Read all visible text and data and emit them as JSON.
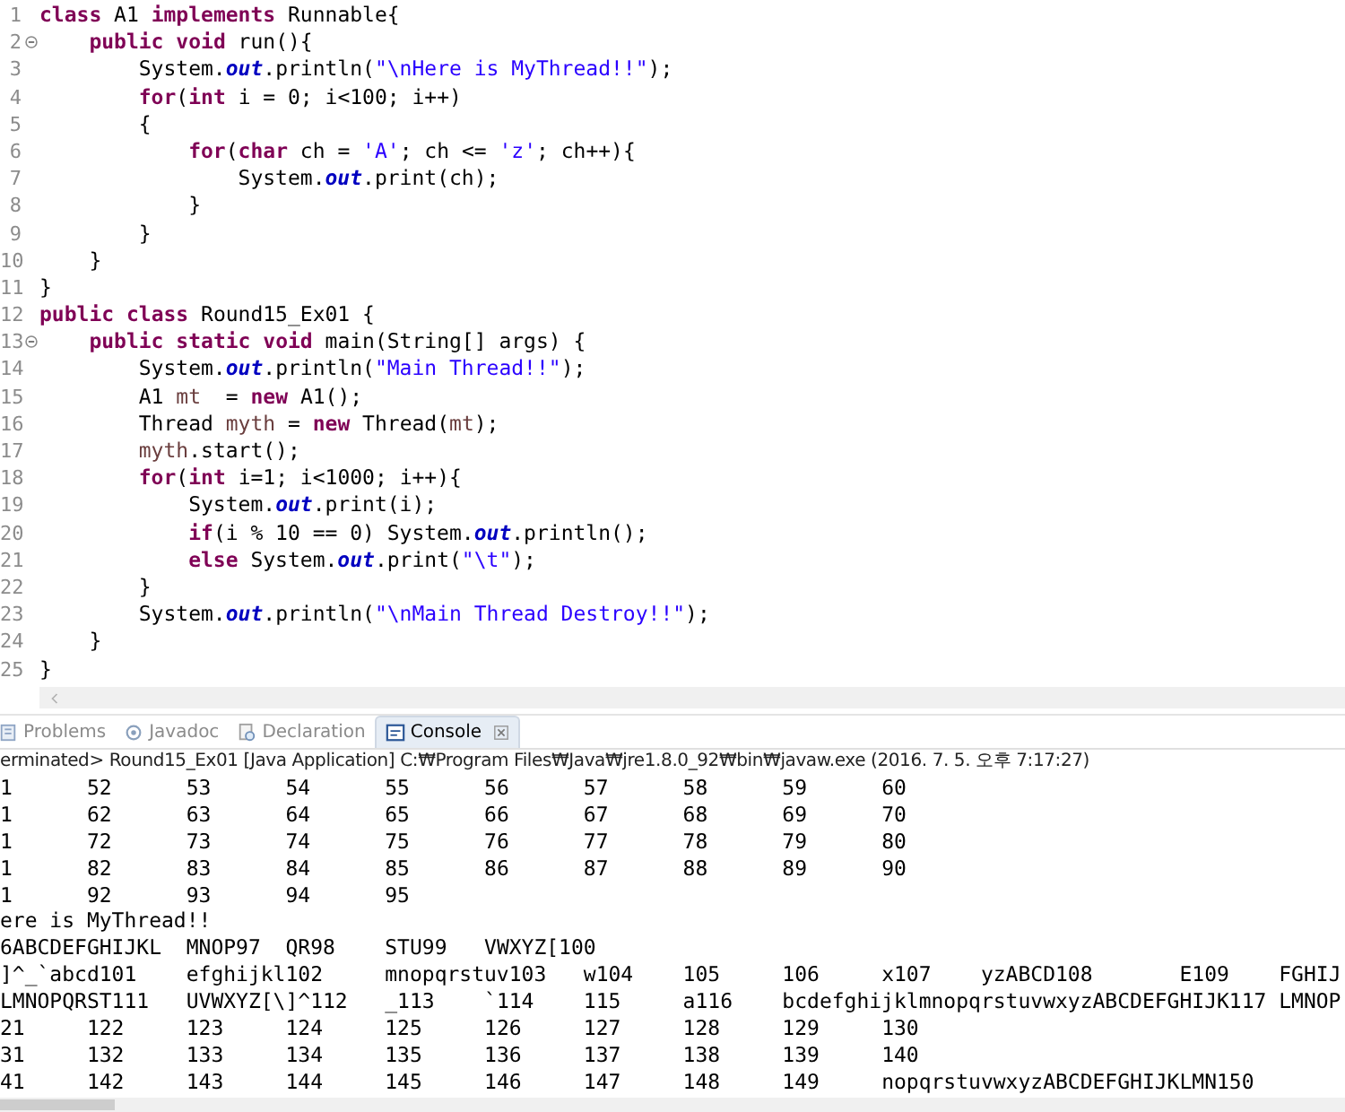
{
  "editor": {
    "lines": [
      {
        "n": "1",
        "fold": false,
        "tokens": [
          {
            "kind": "kw",
            "t": "class"
          },
          {
            "kind": "p",
            "t": " A1 "
          },
          {
            "kind": "kw",
            "t": "implements"
          },
          {
            "kind": "p",
            "t": " Runnable{"
          }
        ]
      },
      {
        "n": "2",
        "fold": true,
        "tokens": [
          {
            "kind": "kw",
            "t": "    public"
          },
          {
            "kind": "kw",
            "t": " void"
          },
          {
            "kind": "p",
            "t": " run(){"
          }
        ]
      },
      {
        "n": "3",
        "fold": false,
        "tokens": [
          {
            "kind": "p",
            "t": "        System."
          },
          {
            "kind": "field",
            "t": "out"
          },
          {
            "kind": "p",
            "t": ".println("
          },
          {
            "kind": "str",
            "t": "\"\\nHere is MyThread!!\""
          },
          {
            "kind": "p",
            "t": ");"
          }
        ]
      },
      {
        "n": "4",
        "fold": false,
        "tokens": [
          {
            "kind": "kw",
            "t": "        for"
          },
          {
            "kind": "p",
            "t": "("
          },
          {
            "kind": "kw",
            "t": "int"
          },
          {
            "kind": "p",
            "t": " i = 0; i<100; i++)"
          }
        ]
      },
      {
        "n": "5",
        "fold": false,
        "tokens": [
          {
            "kind": "p",
            "t": "        {"
          }
        ]
      },
      {
        "n": "6",
        "fold": false,
        "tokens": [
          {
            "kind": "kw",
            "t": "            for"
          },
          {
            "kind": "p",
            "t": "("
          },
          {
            "kind": "kw",
            "t": "char"
          },
          {
            "kind": "p",
            "t": " ch = "
          },
          {
            "kind": "str",
            "t": "'A'"
          },
          {
            "kind": "p",
            "t": "; ch <= "
          },
          {
            "kind": "str",
            "t": "'z'"
          },
          {
            "kind": "p",
            "t": "; ch++){"
          }
        ]
      },
      {
        "n": "7",
        "fold": false,
        "tokens": [
          {
            "kind": "p",
            "t": "                System."
          },
          {
            "kind": "field",
            "t": "out"
          },
          {
            "kind": "p",
            "t": ".print(ch);"
          }
        ]
      },
      {
        "n": "8",
        "fold": false,
        "tokens": [
          {
            "kind": "p",
            "t": "            }"
          }
        ]
      },
      {
        "n": "9",
        "fold": false,
        "tokens": [
          {
            "kind": "p",
            "t": "        }"
          }
        ]
      },
      {
        "n": "10",
        "fold": false,
        "tokens": [
          {
            "kind": "p",
            "t": "    }"
          }
        ]
      },
      {
        "n": "11",
        "fold": false,
        "tokens": [
          {
            "kind": "p",
            "t": "}"
          }
        ]
      },
      {
        "n": "12",
        "fold": false,
        "tokens": [
          {
            "kind": "kw",
            "t": "public"
          },
          {
            "kind": "kw",
            "t": " class"
          },
          {
            "kind": "p",
            "t": " Round15_Ex01 {"
          }
        ]
      },
      {
        "n": "13",
        "fold": true,
        "tokens": [
          {
            "kind": "kw",
            "t": "    public"
          },
          {
            "kind": "kw",
            "t": " static"
          },
          {
            "kind": "kw",
            "t": " void"
          },
          {
            "kind": "p",
            "t": " main(String[] args) {"
          }
        ]
      },
      {
        "n": "14",
        "fold": false,
        "tokens": [
          {
            "kind": "p",
            "t": "        System."
          },
          {
            "kind": "field",
            "t": "out"
          },
          {
            "kind": "p",
            "t": ".println("
          },
          {
            "kind": "str",
            "t": "\"Main Thread!!\""
          },
          {
            "kind": "p",
            "t": ");"
          }
        ]
      },
      {
        "n": "15",
        "fold": false,
        "tokens": [
          {
            "kind": "p",
            "t": "        A1 "
          },
          {
            "kind": "var",
            "t": "mt"
          },
          {
            "kind": "p",
            "t": "  = "
          },
          {
            "kind": "kw",
            "t": "new"
          },
          {
            "kind": "p",
            "t": " A1();"
          }
        ]
      },
      {
        "n": "16",
        "fold": false,
        "tokens": [
          {
            "kind": "p",
            "t": "        Thread "
          },
          {
            "kind": "var",
            "t": "myth"
          },
          {
            "kind": "p",
            "t": " = "
          },
          {
            "kind": "kw",
            "t": "new"
          },
          {
            "kind": "p",
            "t": " Thread("
          },
          {
            "kind": "var",
            "t": "mt"
          },
          {
            "kind": "p",
            "t": ");"
          }
        ]
      },
      {
        "n": "17",
        "fold": false,
        "tokens": [
          {
            "kind": "var",
            "t": "        myth"
          },
          {
            "kind": "p",
            "t": ".start();"
          }
        ]
      },
      {
        "n": "18",
        "fold": false,
        "tokens": [
          {
            "kind": "kw",
            "t": "        for"
          },
          {
            "kind": "p",
            "t": "("
          },
          {
            "kind": "kw",
            "t": "int"
          },
          {
            "kind": "p",
            "t": " i=1; i<1000; i++){"
          }
        ]
      },
      {
        "n": "19",
        "fold": false,
        "tokens": [
          {
            "kind": "p",
            "t": "            System."
          },
          {
            "kind": "field",
            "t": "out"
          },
          {
            "kind": "p",
            "t": ".print(i);"
          }
        ]
      },
      {
        "n": "20",
        "fold": false,
        "tokens": [
          {
            "kind": "kw",
            "t": "            if"
          },
          {
            "kind": "p",
            "t": "(i % 10 == 0) System."
          },
          {
            "kind": "field",
            "t": "out"
          },
          {
            "kind": "p",
            "t": ".println();"
          }
        ]
      },
      {
        "n": "21",
        "fold": false,
        "tokens": [
          {
            "kind": "kw",
            "t": "            else"
          },
          {
            "kind": "p",
            "t": " System."
          },
          {
            "kind": "field",
            "t": "out"
          },
          {
            "kind": "p",
            "t": ".print("
          },
          {
            "kind": "str",
            "t": "\"\\t\""
          },
          {
            "kind": "p",
            "t": ");"
          }
        ]
      },
      {
        "n": "22",
        "fold": false,
        "tokens": [
          {
            "kind": "p",
            "t": "        }"
          }
        ]
      },
      {
        "n": "23",
        "fold": false,
        "tokens": [
          {
            "kind": "p",
            "t": "        System."
          },
          {
            "kind": "field",
            "t": "out"
          },
          {
            "kind": "p",
            "t": ".println("
          },
          {
            "kind": "str",
            "t": "\"\\nMain Thread Destroy!!\""
          },
          {
            "kind": "p",
            "t": ");"
          }
        ]
      },
      {
        "n": "24",
        "fold": false,
        "tokens": [
          {
            "kind": "p",
            "t": "    }"
          }
        ]
      },
      {
        "n": "25",
        "fold": false,
        "tokens": [
          {
            "kind": "p",
            "t": "}"
          }
        ]
      }
    ]
  },
  "tabs": [
    {
      "label": "Problems",
      "kind": "problems",
      "selected": false
    },
    {
      "label": "Javadoc",
      "kind": "javadoc",
      "selected": false
    },
    {
      "label": "Declaration",
      "kind": "declaration",
      "selected": false
    },
    {
      "label": "Console",
      "kind": "console",
      "selected": true
    }
  ],
  "console": {
    "status": "erminated> Round15_Ex01 [Java Application] C:₩Program Files₩Java₩jre1.8.0_92₩bin₩javaw.exe (2016. 7. 5. 오후 7:17:27)",
    "lines": [
      "1\t52\t53\t54\t55\t56\t57\t58\t59\t60",
      "1\t62\t63\t64\t65\t66\t67\t68\t69\t70",
      "1\t72\t73\t74\t75\t76\t77\t78\t79\t80",
      "1\t82\t83\t84\t85\t86\t87\t88\t89\t90",
      "1\t92\t93\t94\t95",
      "ere is MyThread!!",
      "6ABCDEFGHIJKL\tMNOP97\tQR98\tSTU99\tVWXYZ[100",
      "]^_`abcd101\tefghijkl102\tmnopqrstuv103\tw104\t105\t106\tx107\tyzABCD108\tE109\tFGHIJ",
      "LMNOPQRST111\tUVWXYZ[\\]^112\t_113\t`114\t115\ta116\tbcdefghijklmnopqrstuvwxyzABCDEFGHIJK117 LMNOP",
      "21\t122\t123\t124\t125\t126\t127\t128\t129\t130",
      "31\t132\t133\t134\t135\t136\t137\t138\t139\t140",
      "41\t142\t143\t144\t145\t146\t147\t148\t149\tnopqrstuvwxyzABCDEFGHIJKLMN150"
    ]
  }
}
